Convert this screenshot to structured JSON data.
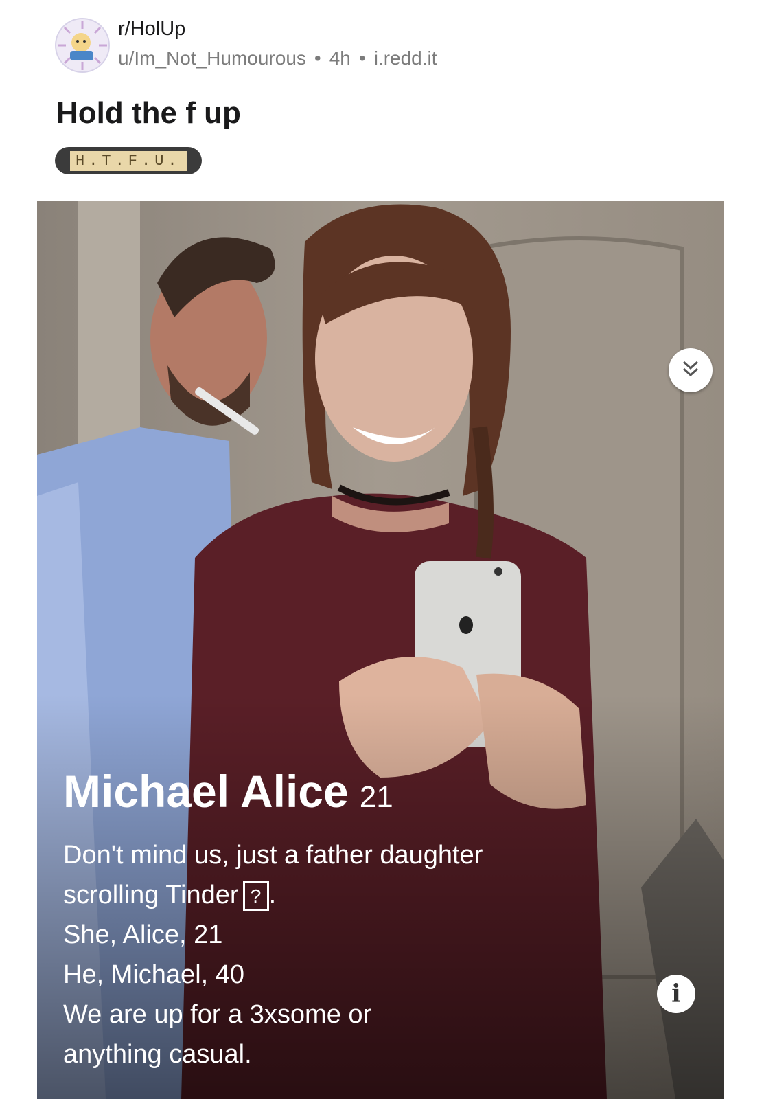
{
  "post": {
    "subreddit": "r/HolUp",
    "author": "u/Im_Not_Humourous",
    "age": "4h",
    "domain": "i.redd.it",
    "separator": "•",
    "title": "Hold the f up",
    "flair": "H.T.F.U."
  },
  "profile": {
    "name": "Michael Alice",
    "age": "21",
    "bio": [
      "Don't mind us, just a father daughter",
      "scrolling Tinder",
      "She, Alice, 21",
      "He, Michael, 40",
      "We are up for a 3xsome or",
      "anything casual."
    ],
    "question_glyph": "?",
    "after_glyph": "."
  },
  "icons": {
    "expand": "chevrons-down-icon",
    "info": "info-icon",
    "info_glyph": "i"
  }
}
